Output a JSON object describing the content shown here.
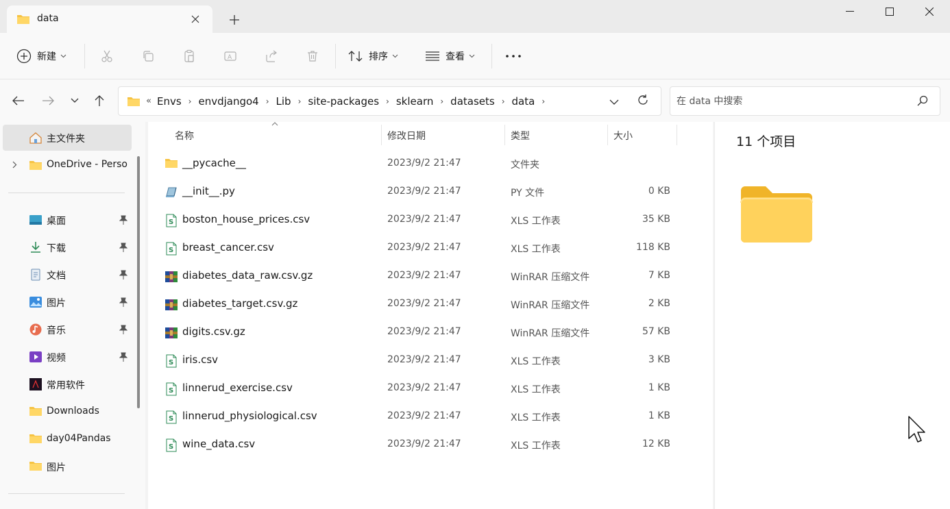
{
  "tab": {
    "title": "data"
  },
  "toolbar": {
    "new_label": "新建",
    "sort_label": "排序",
    "view_label": "查看"
  },
  "breadcrumb": [
    "Envs",
    "envdjango4",
    "Lib",
    "site-packages",
    "sklearn",
    "datasets",
    "data"
  ],
  "breadcrumb_overflow": "«",
  "search": {
    "placeholder": "在 data 中搜索"
  },
  "sidebar": {
    "home": "主文件夹",
    "onedrive": "OneDrive - Perso",
    "pinned": [
      {
        "label": "桌面",
        "icon": "desktop-icon"
      },
      {
        "label": "下载",
        "icon": "download-icon"
      },
      {
        "label": "文档",
        "icon": "document-icon"
      },
      {
        "label": "图片",
        "icon": "pictures-icon"
      },
      {
        "label": "音乐",
        "icon": "music-icon"
      },
      {
        "label": "视频",
        "icon": "video-icon"
      }
    ],
    "folders": [
      "常用软件",
      "Downloads",
      "day04Pandas",
      "图片"
    ]
  },
  "columns": {
    "name": "名称",
    "date": "修改日期",
    "type": "类型",
    "size": "大小"
  },
  "files": [
    {
      "name": "__pycache__",
      "date": "2023/9/2 21:47",
      "type": "文件夹",
      "size": "",
      "icon": "folder-icon"
    },
    {
      "name": "__init__.py",
      "date": "2023/9/2 21:47",
      "type": "PY 文件",
      "size": "0 KB",
      "icon": "python-file-icon"
    },
    {
      "name": "boston_house_prices.csv",
      "date": "2023/9/2 21:47",
      "type": "XLS 工作表",
      "size": "35 KB",
      "icon": "csv-file-icon"
    },
    {
      "name": "breast_cancer.csv",
      "date": "2023/9/2 21:47",
      "type": "XLS 工作表",
      "size": "118 KB",
      "icon": "csv-file-icon"
    },
    {
      "name": "diabetes_data_raw.csv.gz",
      "date": "2023/9/2 21:47",
      "type": "WinRAR 压缩文件",
      "size": "7 KB",
      "icon": "archive-file-icon"
    },
    {
      "name": "diabetes_target.csv.gz",
      "date": "2023/9/2 21:47",
      "type": "WinRAR 压缩文件",
      "size": "2 KB",
      "icon": "archive-file-icon"
    },
    {
      "name": "digits.csv.gz",
      "date": "2023/9/2 21:47",
      "type": "WinRAR 压缩文件",
      "size": "57 KB",
      "icon": "archive-file-icon"
    },
    {
      "name": "iris.csv",
      "date": "2023/9/2 21:47",
      "type": "XLS 工作表",
      "size": "3 KB",
      "icon": "csv-file-icon"
    },
    {
      "name": "linnerud_exercise.csv",
      "date": "2023/9/2 21:47",
      "type": "XLS 工作表",
      "size": "1 KB",
      "icon": "csv-file-icon"
    },
    {
      "name": "linnerud_physiological.csv",
      "date": "2023/9/2 21:47",
      "type": "XLS 工作表",
      "size": "1 KB",
      "icon": "csv-file-icon"
    },
    {
      "name": "wine_data.csv",
      "date": "2023/9/2 21:47",
      "type": "XLS 工作表",
      "size": "12 KB",
      "icon": "csv-file-icon"
    }
  ],
  "details": {
    "count": "11 个项目"
  },
  "colors": {
    "folder": "#f6c343",
    "accent": "#0067c0",
    "selected": "#e4e4e4"
  }
}
